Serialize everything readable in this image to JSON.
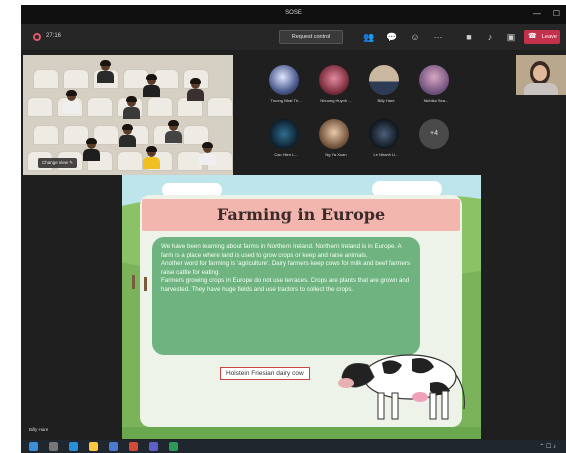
{
  "window": {
    "title": "SOSE"
  },
  "toolbar": {
    "timer": "27:16",
    "request_control_label": "Request control",
    "leave_label": "Leave",
    "icons": [
      "people-icon",
      "chat-icon",
      "reactions-icon",
      "more-icon",
      "camera-icon",
      "mic-icon",
      "share-icon"
    ]
  },
  "video": {
    "change_view_label": "Change view"
  },
  "participants": [
    {
      "name": "Truong Nhat Th..."
    },
    {
      "name": "Nhuong Huynh ..."
    },
    {
      "name": "Billy Hare"
    },
    {
      "name": "Nichika Sea..."
    },
    {
      "name": "Cao Hien L..."
    },
    {
      "name": "Ng Ya Xuan"
    },
    {
      "name": "Le Nhanh Li..."
    }
  ],
  "more_count": "+4",
  "slide": {
    "title": "Farming in Europe",
    "paragraphs": [
      "We have been learning about farms in Northern Ireland. Northern Ireland is in Europe. A farm is a place where land is used to grow crops or keep and raise animals.",
      "Another word for farming is 'agriculture'. Dairy farmers keep cows for milk and beef farmers raise cattle for eating.",
      "Farmers growing crops in Europe do not use terraces. Crops are plants that are grown and harvested. They have huge fields and use tractors to collect the crops."
    ],
    "cow_label": "Holstein Friesian dairy cow"
  },
  "presenter_name": "Billy Hare",
  "colors": {
    "leave": "#c4314b",
    "slide_panel": "#6fb381",
    "title_band": "#f2b6ae"
  }
}
